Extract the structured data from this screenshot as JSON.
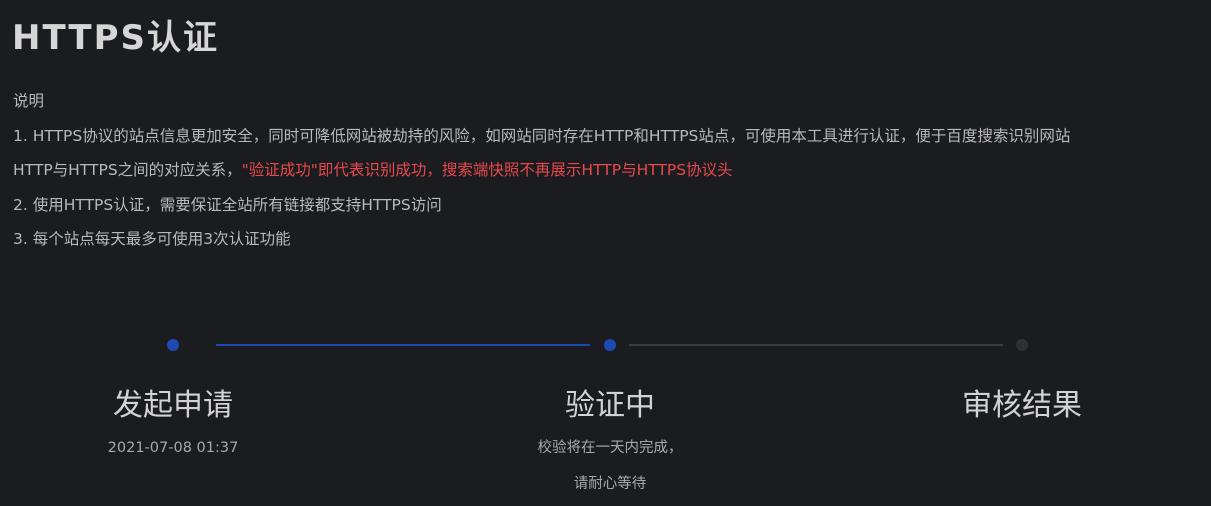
{
  "title": "HTTPS认证",
  "description": {
    "heading": "说明",
    "item1_part1": "1. HTTPS协议的站点信息更加安全，同时可降低网站被劫持的风险，如网站同时存在HTTP和HTTPS站点，可使用本工具进行认证，便于百度搜索识别网站",
    "item1_part2": "HTTP与HTTPS之间的对应关系，",
    "item1_warning": "\"验证成功\"即代表识别成功，搜索端快照不再展示HTTP与HTTPS协议头",
    "item2": "2. 使用HTTPS认证，需要保证全站所有链接都支持HTTPS访问",
    "item3": "3. 每个站点每天最多可使用3次认证功能"
  },
  "progress": {
    "active_color": "#1d4ab5",
    "inactive_color": "#2f3035",
    "current_step": 2,
    "steps": [
      {
        "label": "发起申请",
        "sub1": "2021-07-08 01:37",
        "sub2": ""
      },
      {
        "label": "验证中",
        "sub1": "校验将在一天内完成，",
        "sub2": "请耐心等待"
      },
      {
        "label": "审核结果",
        "sub1": "",
        "sub2": ""
      }
    ]
  }
}
